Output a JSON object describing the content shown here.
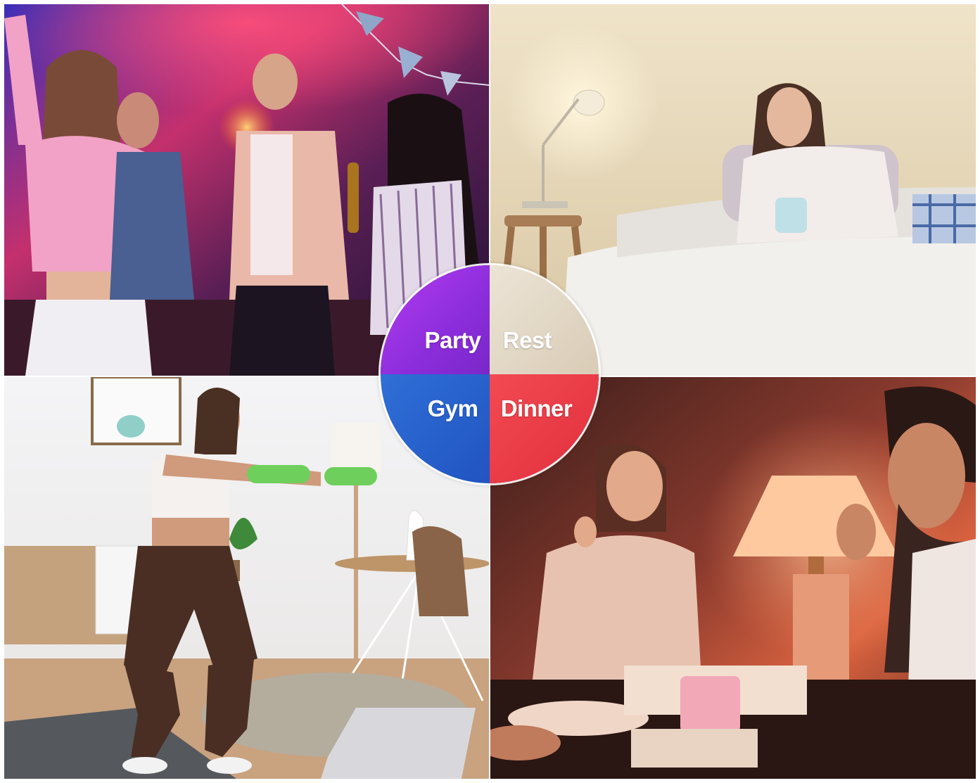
{
  "scenes": {
    "party": {
      "label": "Party",
      "color": "#8c2ddc"
    },
    "rest": {
      "label": "Rest",
      "color": "#e2d7c4"
    },
    "gym": {
      "label": "Gym",
      "color": "#2a63cf"
    },
    "dinner": {
      "label": "Dinner",
      "color": "#e9343f"
    }
  }
}
